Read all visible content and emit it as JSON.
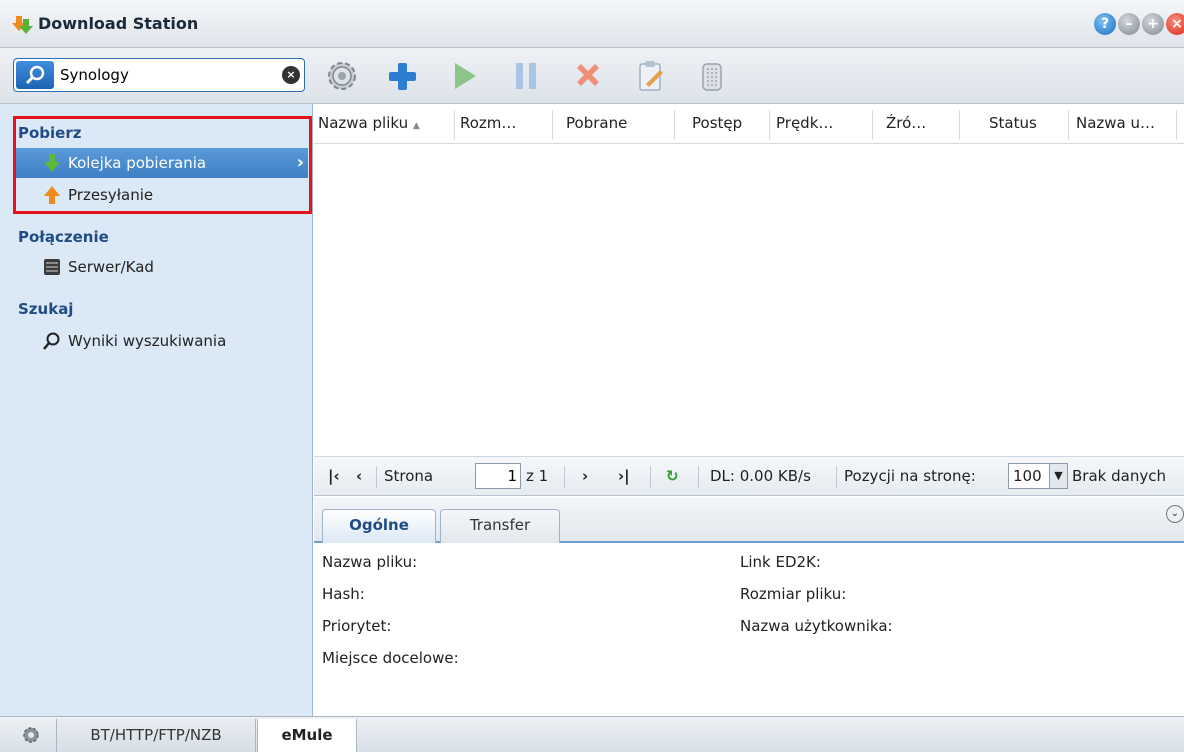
{
  "window": {
    "title": "Download Station",
    "buttons": [
      "help-icon",
      "minimize-icon",
      "maximize-icon",
      "close-icon"
    ]
  },
  "search": {
    "value": "Synology"
  },
  "toolbar": {
    "icons": [
      "settings-icon",
      "add-icon",
      "play-icon",
      "pause-icon",
      "delete-icon",
      "edit-icon",
      "clear-icon"
    ]
  },
  "sidebar": {
    "sections": [
      {
        "title": "Pobierz",
        "items": [
          {
            "label": "Kolejka pobierania",
            "icon": "download-arrow-icon",
            "selected": true
          },
          {
            "label": "Przesyłanie",
            "icon": "upload-arrow-icon",
            "selected": false
          }
        ]
      },
      {
        "title": "Połączenie",
        "items": [
          {
            "label": "Serwer/Kad",
            "icon": "server-icon",
            "selected": false
          }
        ]
      },
      {
        "title": "Szukaj",
        "items": [
          {
            "label": "Wyniki wyszukiwania",
            "icon": "magnifier-icon",
            "selected": false
          }
        ]
      }
    ]
  },
  "grid": {
    "columns": [
      "Nazwa pliku",
      "Rozm…",
      "Pobrane",
      "Postęp",
      "Prędk…",
      "Źró…",
      "Status",
      "Nazwa u…"
    ],
    "sort_indicator": "▲",
    "rows": []
  },
  "pager": {
    "page_label": "Strona",
    "page_value": "1",
    "of_label": "z 1",
    "dl_label": "DL: 0.00 KB/s",
    "per_page_label": "Pozycji na stronę:",
    "per_page_value": "100",
    "empty_label": "Brak danych"
  },
  "detail": {
    "tabs": [
      "Ogólne",
      "Transfer"
    ],
    "active_tab": "Ogólne",
    "left_fields": [
      "Nazwa pliku:",
      "Hash:",
      "Priorytet:",
      "Miejsce docelowe:"
    ],
    "right_fields": [
      "Link ED2K:",
      "Rozmiar pliku:",
      "Nazwa użytkownika:"
    ]
  },
  "bottom_tabs": [
    "BT/HTTP/FTP/NZB",
    "eMule"
  ],
  "active_bottom_tab": "eMule",
  "colors": {
    "accent": "#3e7fc6",
    "sidebar_bg": "#dbe8f6",
    "section_title": "#1f4c84",
    "highlight_border": "#e8121b"
  }
}
